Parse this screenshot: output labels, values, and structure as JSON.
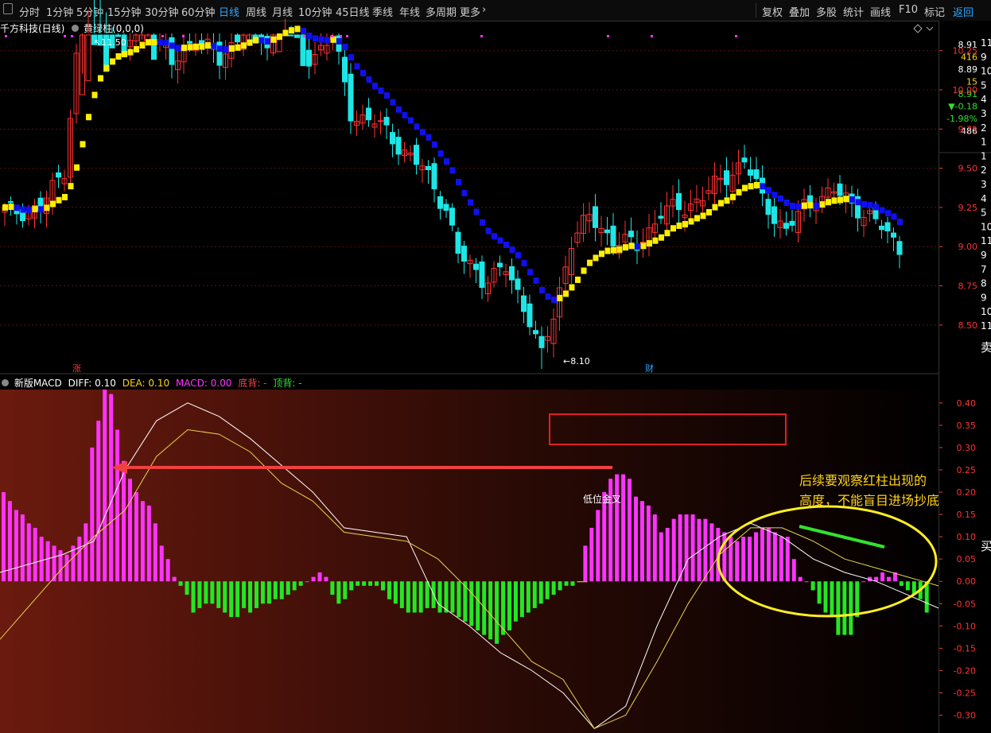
{
  "toolbar": {
    "periods": [
      "分时",
      "1分钟",
      "5分钟",
      "15分钟",
      "30分钟",
      "60分钟",
      "日线",
      "周线",
      "月线",
      "10分钟",
      "45日线",
      "季线",
      "年线",
      "多周期",
      "更多"
    ],
    "active_period": "日线",
    "right_buttons": [
      "复权",
      "叠加",
      "多股",
      "统计",
      "画线",
      "F10",
      "标记",
      "返回"
    ]
  },
  "kline_panel": {
    "stock_name": "千方科技(日线)",
    "indicator": "黄绿柱(0,0,0)",
    "high_marker": "11.50",
    "low_marker": "8.10",
    "event_flags": [
      "涨",
      "财"
    ],
    "price_ticks": [
      "10.25",
      "10.00",
      "9.75",
      "9.50",
      "9.25",
      "9.00",
      "8.75",
      "8.50"
    ]
  },
  "quote_panel": {
    "values": [
      "8.91",
      "416",
      "8.89",
      "15",
      "8.91",
      "▼-0.18",
      "-1.98%",
      "486"
    ],
    "colors": [
      "#ffffff",
      "#ffd21a",
      "#ffffff",
      "#ffd21a",
      "#2ee02e",
      "#2ee02e",
      "#2ee02e",
      "#ffffff"
    ],
    "edge_digits": [
      "11",
      "9",
      "10",
      "5",
      "4",
      "3",
      "2",
      "1",
      "1",
      "2",
      "3",
      "4",
      "5",
      "10",
      "11",
      "9",
      "7",
      "8",
      "9",
      "10",
      "11"
    ],
    "sell_label": "卖",
    "buy_label": "买"
  },
  "macd_panel": {
    "name": "新版MACD",
    "diff_text": "DIFF: 0.10",
    "dea_text": "DEA: 0.10",
    "macd_text": "MACD: 0.00",
    "bottom_div": "底背: -",
    "top_div": "顶背: -",
    "cross_label": "低位金叉",
    "y_ticks": [
      "0.40",
      "0.35",
      "0.30",
      "0.25",
      "0.20",
      "0.15",
      "0.10",
      "0.05",
      "0.00",
      "-0.05",
      "-0.10",
      "-0.15",
      "-0.20",
      "-0.25",
      "-0.30"
    ]
  },
  "annotation": {
    "note_line1": "后续要观察红柱出现的",
    "note_line2": "高度，不能盲目进场抄底"
  },
  "chart_data": [
    {
      "type": "candlestick",
      "title": "千方科技(日线)",
      "ylim": [
        8.2,
        10.35
      ],
      "y_ticks": [
        10.25,
        10.0,
        9.75,
        9.5,
        9.25,
        9.0,
        8.75,
        8.5
      ],
      "annotations": [
        {
          "label": "11.50",
          "kind": "period-high"
        },
        {
          "label": "8.10",
          "kind": "period-low"
        }
      ],
      "overlay_series": "黄绿柱(0,0,0)",
      "overlay_colors": {
        "rising": "#ffee00",
        "falling": "#1010ee"
      }
    },
    {
      "type": "bar",
      "title": "新版MACD",
      "ylim": [
        -0.34,
        0.43
      ],
      "y_ticks": [
        0.4,
        0.35,
        0.3,
        0.25,
        0.2,
        0.15,
        0.1,
        0.05,
        0.0,
        -0.05,
        -0.1,
        -0.15,
        -0.2,
        -0.25,
        -0.3
      ],
      "series": [
        {
          "name": "MACD",
          "values": [
            0.2,
            0.18,
            0.16,
            0.15,
            0.13,
            0.12,
            0.1,
            0.09,
            0.08,
            0.07,
            0.06,
            0.08,
            0.1,
            0.13,
            0.3,
            0.36,
            0.43,
            0.42,
            0.34,
            0.27,
            0.23,
            0.2,
            0.18,
            0.17,
            0.13,
            0.08,
            0.05,
            0.01,
            -0.01,
            -0.03,
            -0.07,
            -0.06,
            -0.05,
            -0.05,
            -0.06,
            -0.07,
            -0.08,
            -0.08,
            -0.06,
            -0.07,
            -0.06,
            -0.05,
            -0.05,
            -0.04,
            -0.04,
            -0.03,
            -0.02,
            -0.01,
            0.0,
            0.01,
            0.02,
            0.01,
            -0.03,
            -0.05,
            -0.04,
            -0.02,
            -0.01,
            -0.01,
            -0.01,
            -0.01,
            -0.02,
            -0.04,
            -0.05,
            -0.06,
            -0.07,
            -0.07,
            -0.07,
            -0.06,
            -0.06,
            -0.07,
            -0.07,
            -0.07,
            -0.08,
            -0.09,
            -0.1,
            -0.11,
            -0.12,
            -0.13,
            -0.14,
            -0.12,
            -0.11,
            -0.09,
            -0.08,
            -0.07,
            -0.06,
            -0.05,
            -0.04,
            -0.03,
            -0.02,
            -0.01,
            -0.01,
            0.0,
            0.08,
            0.12,
            0.16,
            0.2,
            0.23,
            0.24,
            0.24,
            0.23,
            0.19,
            0.18,
            0.17,
            0.15,
            0.11,
            0.12,
            0.14,
            0.15,
            0.15,
            0.15,
            0.14,
            0.14,
            0.13,
            0.12,
            0.11,
            0.1,
            0.09,
            0.1,
            0.1,
            0.11,
            0.12,
            0.12,
            0.11,
            0.1,
            0.1,
            0.05,
            0.01,
            0.0,
            -0.02,
            -0.05,
            -0.07,
            -0.08,
            -0.12,
            -0.12,
            -0.12,
            -0.08,
            0.0,
            0.01,
            0.01,
            0.02,
            0.01,
            0.02,
            -0.01,
            -0.02,
            -0.03,
            -0.04,
            -0.07
          ]
        },
        {
          "name": "DIFF",
          "values": [
            0.02,
            0.04,
            0.06,
            0.09,
            0.25,
            0.36,
            0.4,
            0.37,
            0.32,
            0.26,
            0.2,
            0.12,
            0.11,
            0.1,
            -0.05,
            -0.1,
            -0.16,
            -0.2,
            -0.25,
            -0.33,
            -0.28,
            -0.1,
            0.05,
            0.1,
            0.13,
            0.1,
            0.05,
            0.02,
            0.0,
            -0.03,
            -0.06
          ]
        },
        {
          "name": "DEA",
          "values": [
            -0.13,
            -0.05,
            0.03,
            0.1,
            0.16,
            0.28,
            0.34,
            0.33,
            0.29,
            0.22,
            0.18,
            0.11,
            0.1,
            0.09,
            0.05,
            -0.02,
            -0.1,
            -0.18,
            -0.22,
            -0.33,
            -0.3,
            -0.18,
            -0.05,
            0.06,
            0.12,
            0.12,
            0.09,
            0.05,
            0.03,
            0.01,
            -0.01
          ]
        }
      ],
      "highlight_bar": {
        "label": "低位金叉",
        "color": "#ffee00"
      }
    }
  ]
}
